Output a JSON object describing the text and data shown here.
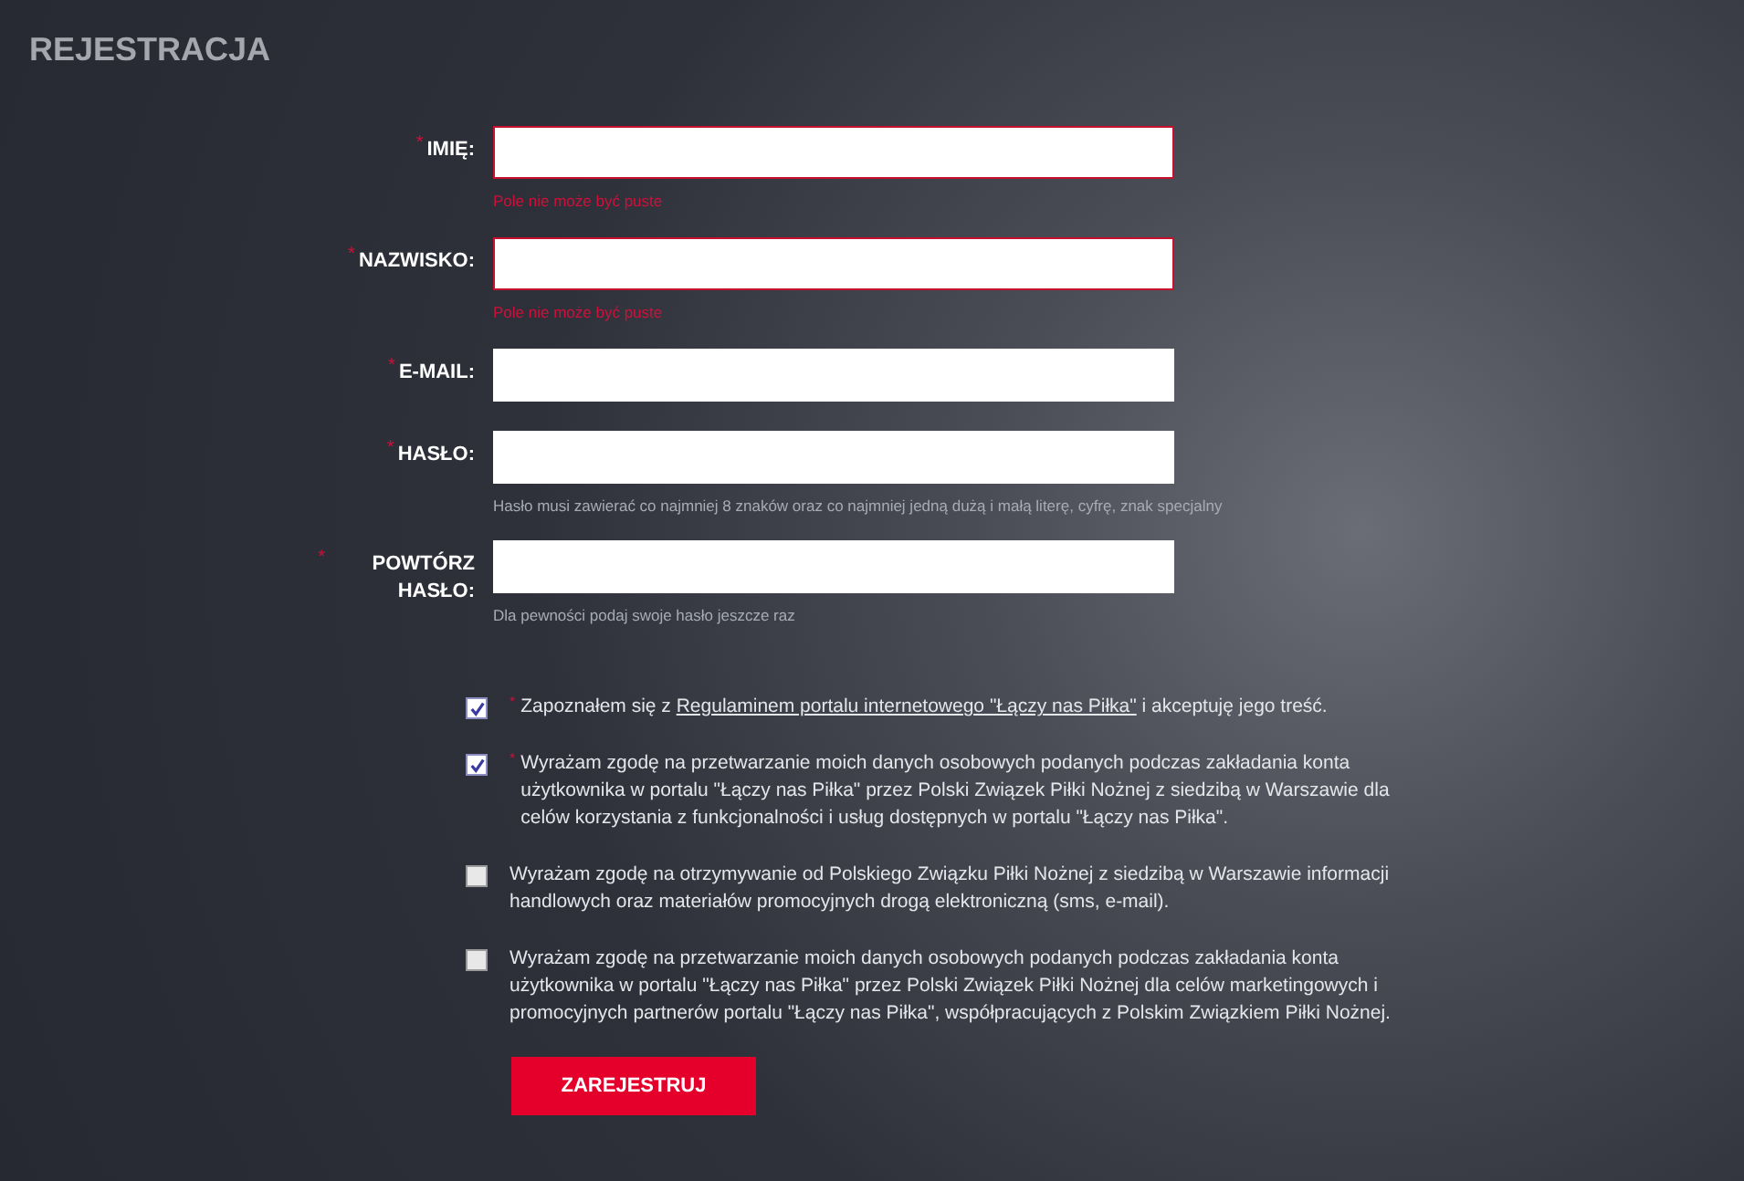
{
  "title": "REJESTRACJA",
  "fields": [
    {
      "label": "IMIĘ:",
      "required_mark": "*",
      "invalid": true,
      "message": "Pole nie może być puste"
    },
    {
      "label": "NAZWISKO:",
      "required_mark": "*",
      "invalid": true,
      "message": "Pole nie może być puste"
    },
    {
      "label": "E-MAIL:",
      "required_mark": "*",
      "invalid": false
    },
    {
      "label": "HASŁO:",
      "required_mark": "*",
      "invalid": false,
      "message": "Hasło musi zawierać co najmniej 8 znaków oraz co najmniej jedną dużą i małą literę, cyfrę, znak specjalny"
    },
    {
      "label": "POWTÓRZ HASŁO:",
      "required_mark": "*",
      "invalid": false,
      "message": "Dla pewności podaj swoje hasło jeszcze raz"
    }
  ],
  "consents": [
    {
      "checked": true,
      "required_mark": "*",
      "text": "Zapoznałem się z ",
      "link": "Regulaminem portalu internetowego \"Łączy nas Piłka\"",
      "text_after": " i akceptuję jego treść."
    },
    {
      "checked": true,
      "required_mark": "*",
      "text": "Wyrażam zgodę na przetwarzanie moich danych osobowych podanych podczas zakładania konta użytkownika w portalu \"Łączy nas Piłka\" przez Polski Związek Piłki Nożnej z siedzibą w Warszawie dla celów korzystania z funkcjonalności i usług dostępnych w portalu \"Łączy nas Piłka\"."
    },
    {
      "checked": false,
      "text": "Wyrażam zgodę na otrzymywanie od Polskiego Związku Piłki Nożnej z siedzibą w Warszawie informacji handlowych oraz materiałów promocyjnych drogą elektroniczną (sms, e-mail)."
    },
    {
      "checked": false,
      "text": "Wyrażam zgodę na przetwarzanie moich danych osobowych podanych podczas zakładania konta użytkownika w portalu \"Łączy nas Piłka\" przez Polski Związek Piłki Nożnej dla celów marketingowych i promocyjnych partnerów portalu \"Łączy nas Piłka\", współpracujących z Polskim Związkiem Piłki Nożnej."
    }
  ],
  "submit": "ZAREJESTRUJ"
}
